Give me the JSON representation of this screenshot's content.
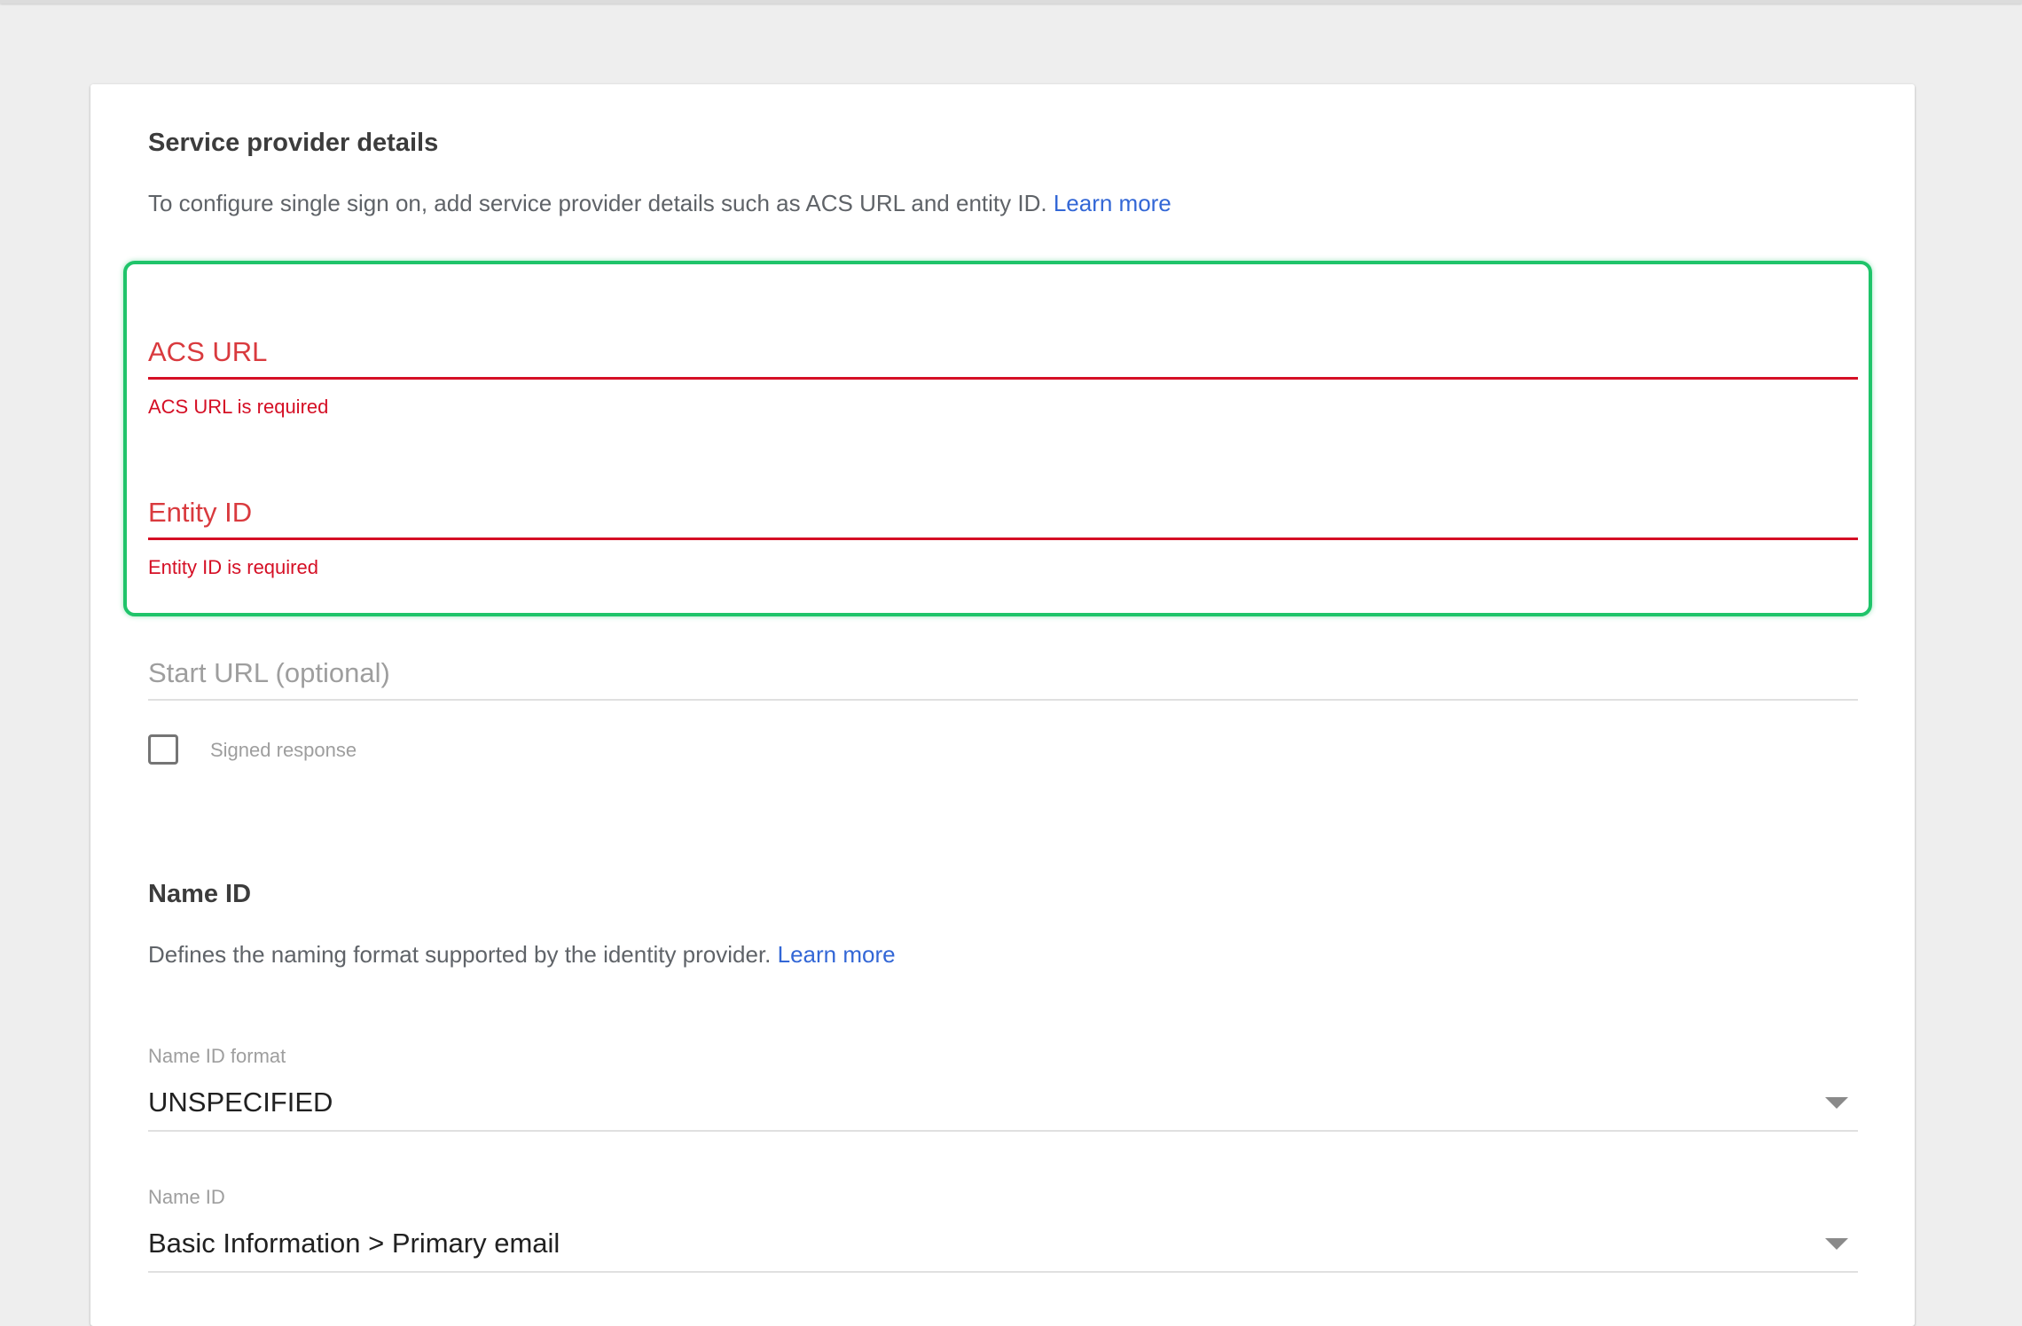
{
  "service_provider": {
    "title": "Service provider details",
    "description": "To configure single sign on, add service provider details such as ACS URL and entity ID.",
    "learn_more": "Learn more",
    "acs_url": {
      "label": "ACS URL",
      "value": "",
      "error": "ACS URL is required"
    },
    "entity_id": {
      "label": "Entity ID",
      "value": "",
      "error": "Entity ID is required"
    },
    "start_url": {
      "placeholder": "Start URL (optional)",
      "value": ""
    },
    "signed_response": {
      "label": "Signed response",
      "checked": false
    }
  },
  "name_id_section": {
    "title": "Name ID",
    "description": "Defines the naming format supported by the identity provider.",
    "learn_more": "Learn more",
    "name_id_format": {
      "label": "Name ID format",
      "value": "UNSPECIFIED"
    },
    "name_id": {
      "label": "Name ID",
      "value": "Basic Information > Primary email"
    }
  },
  "colors": {
    "error": "#d50f25",
    "link": "#3367d6",
    "highlight": "#1fc46a",
    "background": "#eeeeee"
  },
  "icons": {
    "select_caret": "caret-down-icon"
  }
}
